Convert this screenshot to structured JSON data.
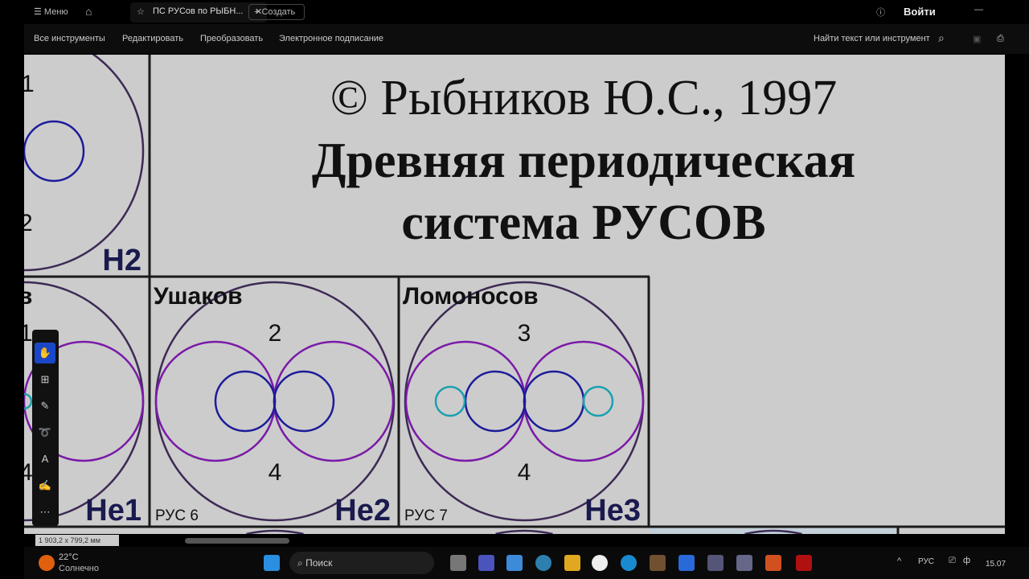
{
  "titlebar": {
    "menu": "Меню",
    "tab_title": "ПС РУСов по РЫБН...",
    "create": "Создать",
    "login": "Войти"
  },
  "toolbar": {
    "items": [
      "Все инструменты",
      "Редактировать",
      "Преобразовать",
      "Электронное подписание"
    ],
    "search": "Найти текст или инструмент"
  },
  "document": {
    "title_line1": "© Рыбников Ю.С., 1997",
    "title_line2": "Древняя периодическая",
    "title_line3": "система РУСОВ",
    "cells": [
      {
        "symbol": "H2",
        "numbers": [
          "1",
          "2"
        ]
      },
      {
        "name_fragment": "в",
        "symbol": "He1",
        "numbers": [
          "1",
          "4"
        ]
      },
      {
        "name": "Ушаков",
        "rus": "РУС 6",
        "symbol": "He2",
        "numbers": [
          "2",
          "4"
        ]
      },
      {
        "name": "Ломоносов",
        "rus": "РУС 7",
        "symbol": "He3",
        "numbers": [
          "3",
          "4"
        ]
      }
    ],
    "colors": {
      "outer": "#3d2a55",
      "purple": "#7a1aa8",
      "blue": "#1c1c9a",
      "cyan": "#1aa0b0",
      "symbol": "#1a1a4e"
    }
  },
  "statusbar": {
    "dimensions": "1 903,2 x 799,2 мм"
  },
  "taskbar": {
    "temp": "22°C",
    "weather": "Солнечно",
    "search": "Поиск",
    "lang": "РУС",
    "time": "15.07"
  }
}
